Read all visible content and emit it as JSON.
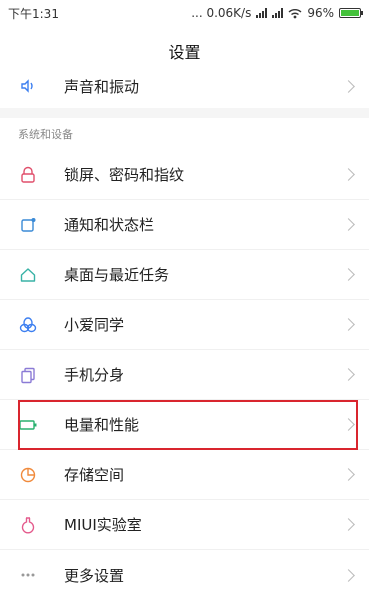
{
  "status_bar": {
    "time": "下午1:31",
    "network_speed": "... 0.06K/s",
    "battery_percent": "96%"
  },
  "header": {
    "title": "设置"
  },
  "items": [
    {
      "label": "声音和振动",
      "icon": "speaker-icon"
    },
    {
      "label": "锁屏、密码和指纹",
      "icon": "lock-icon"
    },
    {
      "label": "通知和状态栏",
      "icon": "notification-icon"
    },
    {
      "label": "桌面与最近任务",
      "icon": "home-icon"
    },
    {
      "label": "小爱同学",
      "icon": "assistant-icon"
    },
    {
      "label": "手机分身",
      "icon": "dual-phone-icon"
    },
    {
      "label": "电量和性能",
      "icon": "battery-icon"
    },
    {
      "label": "存储空间",
      "icon": "storage-pie-icon"
    },
    {
      "label": "MIUI实验室",
      "icon": "lab-flask-icon"
    },
    {
      "label": "更多设置",
      "icon": "more-icon"
    }
  ],
  "section": {
    "title": "系统和设备"
  },
  "colors": {
    "highlight": "#d9252e",
    "lock": "#e04f6b",
    "notification": "#3a8ad6",
    "home": "#39b2a6",
    "assistant": "#3d7ff0",
    "dual": "#8b7bd6",
    "battery": "#28b06f",
    "storage": "#f08a3c",
    "lab": "#e45a8c",
    "speaker": "#3d7ff0"
  }
}
